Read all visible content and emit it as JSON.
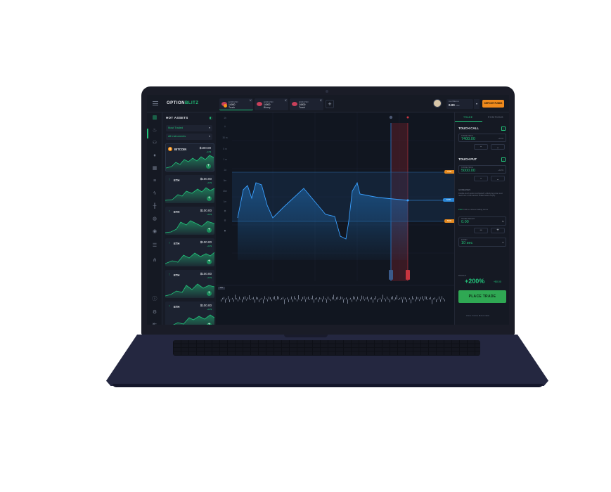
{
  "app": {
    "logo_main": "OPTION",
    "logo_accent": "BLITZ",
    "deposit_label": "DEPOSIT FUNDS",
    "balance_label": "Live Balance",
    "balance_value": "0.00",
    "balance_currency": "USD"
  },
  "tabs": [
    {
      "line1": "EUR/USD",
      "line2": "14000",
      "line3": "Touch"
    },
    {
      "line1": "EUR/USD",
      "line2": "14000",
      "line3": "Binary"
    },
    {
      "line1": "EUR/USD",
      "line2": "14000",
      "line3": "Touch"
    }
  ],
  "sidebar_icons": [
    "bar-chart-icon",
    "fire-icon",
    "users-icon",
    "drop-icon",
    "calendar-icon",
    "chart-icon",
    "bolt-icon",
    "candles-icon",
    "globe-icon",
    "target-icon",
    "database-icon",
    "network-icon",
    "info-icon",
    "gear-icon",
    "logout-icon"
  ],
  "assets": {
    "title": "HOT ASSETS",
    "filter1": "Most Traded",
    "filter2": "All Instruments",
    "items": [
      {
        "name": "BITCOIN",
        "price": "$100.00",
        "change": "+10$"
      },
      {
        "name": "ETH",
        "price": "$100.00",
        "change": "+10$"
      },
      {
        "name": "ETH",
        "price": "$100.00",
        "change": "+10$"
      },
      {
        "name": "ETH",
        "price": "$100.00",
        "change": "+10$"
      },
      {
        "name": "ETH",
        "price": "$100.00",
        "change": "+10$"
      },
      {
        "name": "ETH",
        "price": "$100.00",
        "change": "+10$"
      }
    ]
  },
  "chart": {
    "timeframes": [
      "1h",
      "30 m",
      "5 m",
      "1 m",
      "1d",
      "5m",
      "15m",
      "1m",
      "2 m",
      "1m"
    ],
    "volume_label": "VOL",
    "tag_upper": "7400",
    "tag_mid": "6200",
    "tag_lower": "5000"
  },
  "panel": {
    "tab_trade": "TRADE",
    "tab_positions": "POSITIONS",
    "call_title": "TOUCH CALL",
    "call_label": "STRIKE PRICE",
    "call_value": "7400.00",
    "call_pct": "+10%",
    "put_title": "TOUCH PUT",
    "put_label": "STRIKE PRICE",
    "put_value": "5000.00",
    "put_pct": "+10%",
    "note_title": "GUIDELINES",
    "note_text": "Double-touch option configured. Underlying price must reach one of the barriers strikes before expiry.",
    "link_prefix": "PRO",
    "link_text": "Click to review trading terms",
    "amount_label": "TRADE AMOUNT",
    "amount_value": "0.00",
    "amount_currency": "$",
    "minus": "−",
    "plus": "+",
    "expiry_label": "EXPIRY",
    "expiry_value": "10 sec",
    "payout_label": "PAYOUT",
    "payout_value": "+200%",
    "payout_amount": "+$0.00",
    "place_label": "PLACE TRADE",
    "footer": "FINAL TOUCH BUILD VIEW"
  }
}
